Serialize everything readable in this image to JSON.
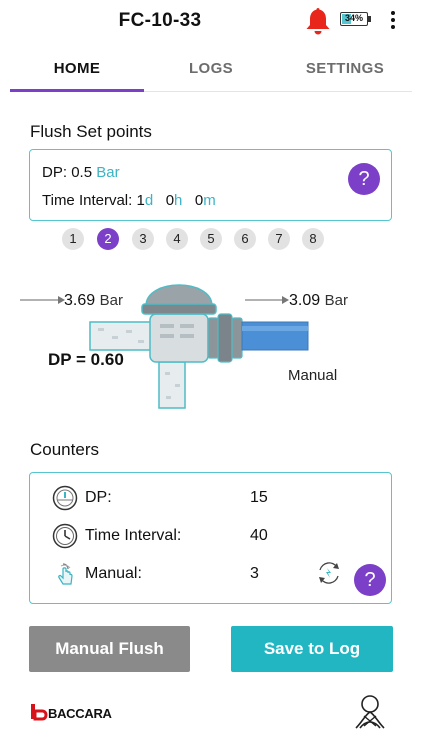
{
  "header": {
    "title": "FC-10-33",
    "battery_percent": "34%",
    "battery_level": 0.34,
    "bell_color": "#e8261c",
    "icons": [
      "bell-icon",
      "battery-icon",
      "more-vert-icon"
    ]
  },
  "tabs": [
    {
      "label": "HOME",
      "active": true
    },
    {
      "label": "LOGS",
      "active": false
    },
    {
      "label": "SETTINGS",
      "active": false
    }
  ],
  "setpoints": {
    "title": "Flush Set points",
    "dp_label": "DP:",
    "dp_value": "0.5",
    "dp_unit": "Bar",
    "interval_label": "Time Interval:",
    "days": "1",
    "days_unit": "d",
    "hours": "0",
    "hours_unit": "h",
    "minutes": "0",
    "minutes_unit": "m",
    "help": "?"
  },
  "pages": [
    "1",
    "2",
    "3",
    "4",
    "5",
    "6",
    "7",
    "8"
  ],
  "active_page": "2",
  "diagram": {
    "inlet_pressure": "3.69",
    "outlet_pressure": "3.09",
    "unit": "Bar",
    "dp_text": "DP = 0.60",
    "mode": "Manual"
  },
  "counters": {
    "title": "Counters",
    "rows": [
      {
        "label": "DP:",
        "value": "15",
        "icon": "gauge-icon"
      },
      {
        "label": "Time Interval:",
        "value": "40",
        "icon": "clock-icon"
      },
      {
        "label": "Manual:",
        "value": "3",
        "icon": "touch-icon"
      }
    ],
    "help": "?"
  },
  "buttons": {
    "manual_flush": "Manual Flush",
    "save_to_log": "Save to Log"
  },
  "footer": {
    "brand": "BACCARA"
  },
  "colors": {
    "accent_purple": "#7b3fc8",
    "accent_teal": "#22b6c3",
    "box_border": "#57c5cf",
    "button_gray": "#8a8a8a"
  }
}
